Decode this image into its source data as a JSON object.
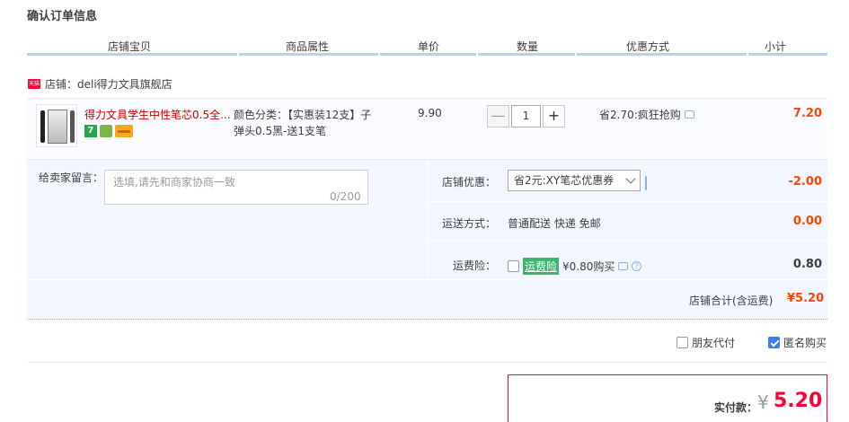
{
  "page": {
    "title": "确认订单信息"
  },
  "columns": [
    "店铺宝贝",
    "商品属性",
    "单价",
    "数量",
    "优惠方式",
    "小计"
  ],
  "shop": {
    "name": "店铺：deli得力文具旗舰店",
    "badge": "天猫"
  },
  "item": {
    "title": "得力文具学生中性笔芯0.5全...",
    "sku_line1": "颜色分类：【实惠装12支】子",
    "sku_line2": "弹头0.5黑-送1支笔",
    "price": "9.90",
    "quantity": "1",
    "qty_minus": "—",
    "qty_plus": "+",
    "icon_badge": "7",
    "promo": "省2.70:疯狂抢购",
    "subtotal": "7.20"
  },
  "message": {
    "label": "给卖家留言：",
    "placeholder": "选填,请先和商家协商一致",
    "count": "0/200"
  },
  "coupon": {
    "label": "店铺优惠：",
    "selected": "省2元:XY笔芯优惠券",
    "amount": "-2.00"
  },
  "shipping": {
    "label": "运送方式：",
    "value": "普通配送 快递 免邮",
    "amount": "0.00"
  },
  "insurance": {
    "label": "运费险：",
    "tag": "运费险",
    "text": "¥0.80购买",
    "amount": "0.80",
    "checked": false
  },
  "store_total": {
    "label": "店铺合计(含运费)",
    "value": "¥5.20"
  },
  "options": {
    "friend_pay": {
      "label": "朋友代付",
      "checked": false
    },
    "anonymous": {
      "label": "匿名购买",
      "checked": true
    }
  },
  "payment": {
    "label": "实付款：",
    "currency": "¥",
    "amount": "5.20"
  },
  "colors": {
    "accent_red": "#ff4400",
    "price_red": "#ff0036",
    "header_rule": "#b2d1ff",
    "panel_bg": "#f2f7ff"
  }
}
